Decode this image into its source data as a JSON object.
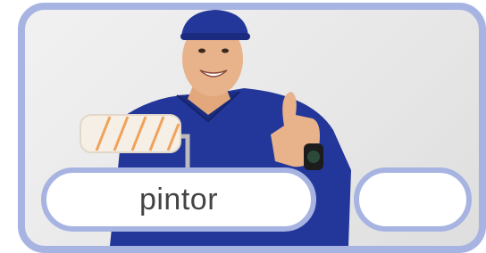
{
  "card": {
    "accent_color": "#a7b4e2"
  },
  "image": {
    "subject_icon": "painter-icon"
  },
  "label": {
    "text": "pintor"
  },
  "answer": {
    "value": ""
  }
}
